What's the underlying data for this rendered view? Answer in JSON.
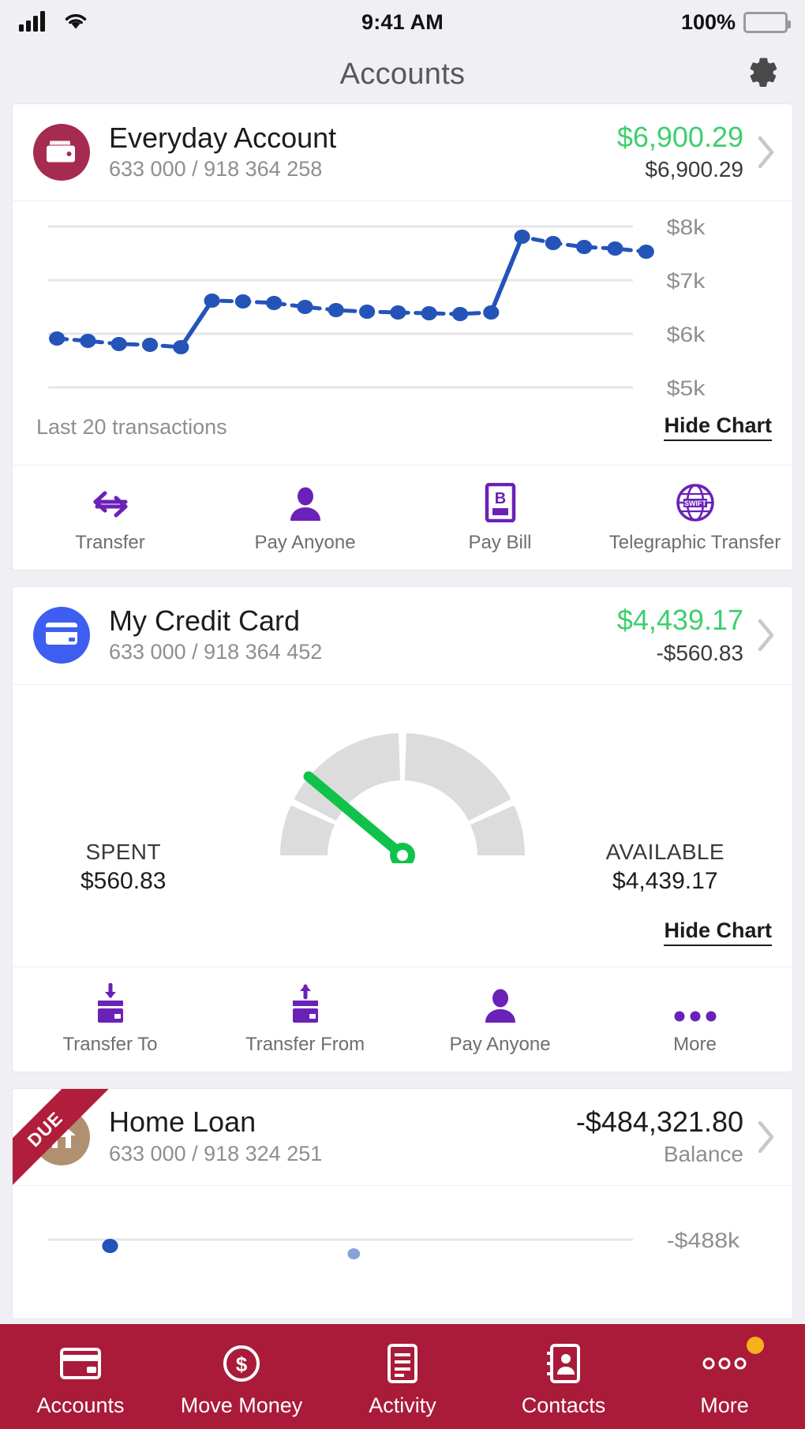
{
  "status_bar": {
    "time": "9:41 AM",
    "battery_percent": "100%",
    "signal_icon": "cellular-signal-icon",
    "wifi_icon": "wifi-icon",
    "battery_icon": "battery-full-icon"
  },
  "nav": {
    "title": "Accounts",
    "settings_icon": "gear-icon"
  },
  "accounts": [
    {
      "name": "Everyday Account",
      "number": "633 000  /  918 364 258",
      "primary_amount": "$6,900.29",
      "secondary_amount": "$6,900.29",
      "primary_color": "#3dcf6e",
      "avatar_color": "#a62b50",
      "avatar_icon": "wallet-icon",
      "chart_foot_label": "Last 20 transactions",
      "hide_chart_label": "Hide Chart",
      "actions": [
        {
          "label": "Transfer",
          "icon": "transfer-arrows-icon"
        },
        {
          "label": "Pay Anyone",
          "icon": "person-icon"
        },
        {
          "label": "Pay Bill",
          "icon": "bpay-icon"
        },
        {
          "label": "Telegraphic Transfer",
          "icon": "swift-globe-icon"
        }
      ]
    },
    {
      "name": "My Credit Card",
      "number": "633 000  /  918 364 452",
      "primary_amount": "$4,439.17",
      "secondary_amount": "-$560.83",
      "primary_color": "#3dcf6e",
      "avatar_color": "#3d5ef0",
      "avatar_icon": "credit-card-icon",
      "spent_caption": "SPENT",
      "spent_value": "$560.83",
      "available_caption": "AVAILABLE",
      "available_value": "$4,439.17",
      "hide_chart_label": "Hide Chart",
      "actions": [
        {
          "label": "Transfer To",
          "icon": "card-arrow-down-icon"
        },
        {
          "label": "Transfer From",
          "icon": "card-arrow-up-icon"
        },
        {
          "label": "Pay Anyone",
          "icon": "person-icon"
        },
        {
          "label": "More",
          "icon": "ellipsis-icon"
        }
      ]
    },
    {
      "name": "Home Loan",
      "number": "633 000  /  918 324 251",
      "primary_amount": "-$484,321.80",
      "secondary_amount": "Balance",
      "primary_color": "#1c1c1c",
      "avatar_color": "#b09070",
      "avatar_icon": "house-icon",
      "badge": "DUE",
      "badge_color": "#b01e3c"
    }
  ],
  "tabbar": {
    "background": "#a91b39",
    "items": [
      {
        "label": "Accounts",
        "icon": "credit-card-icon",
        "active": true
      },
      {
        "label": "Move Money",
        "icon": "dollar-coin-icon",
        "active": false
      },
      {
        "label": "Activity",
        "icon": "list-document-icon",
        "active": false
      },
      {
        "label": "Contacts",
        "icon": "contact-book-icon",
        "active": false
      },
      {
        "label": "More",
        "icon": "ellipsis-icon",
        "active": false,
        "badge_dot": true,
        "badge_color": "#f5b01a"
      }
    ]
  },
  "chart_data": [
    {
      "type": "line",
      "title": "Everyday Account balance",
      "xlabel": "",
      "ylabel": "",
      "ylim": [
        5000,
        8000
      ],
      "ytick_labels": [
        "$8k",
        "$7k",
        "$6k",
        "$5k"
      ],
      "ytick_values": [
        8000,
        7000,
        6000,
        5000
      ],
      "grid": true,
      "legend": "none",
      "series_color": "#2454b8",
      "x": [
        1,
        2,
        3,
        4,
        5,
        6,
        7,
        8,
        9,
        10,
        11,
        12,
        13,
        14,
        15,
        16,
        17,
        18,
        19,
        20
      ],
      "values": [
        6080,
        6040,
        5990,
        5980,
        5940,
        6620,
        6610,
        6580,
        6500,
        6450,
        6420,
        6400,
        6390,
        6370,
        6400,
        7300,
        7180,
        7120,
        7090,
        7040
      ],
      "caption": "Last 20 transactions"
    },
    {
      "type": "gauge",
      "title": "My Credit Card utilisation",
      "segments": 4,
      "segment_color": "#dcdcdc",
      "needle_color": "#10c24b",
      "spent": 560.83,
      "available": 4439.17,
      "limit": 5000.0,
      "needle_angle_deg": -140,
      "labels": {
        "left_caption": "SPENT",
        "left_value": "$560.83",
        "right_caption": "AVAILABLE",
        "right_value": "$4,439.17"
      }
    },
    {
      "type": "line",
      "title": "Home Loan balance (partially visible)",
      "ytick_labels": [
        "-$488k"
      ],
      "ytick_values": [
        -488000
      ],
      "series_color": "#2454b8",
      "grid": true,
      "values": [],
      "x": []
    }
  ]
}
